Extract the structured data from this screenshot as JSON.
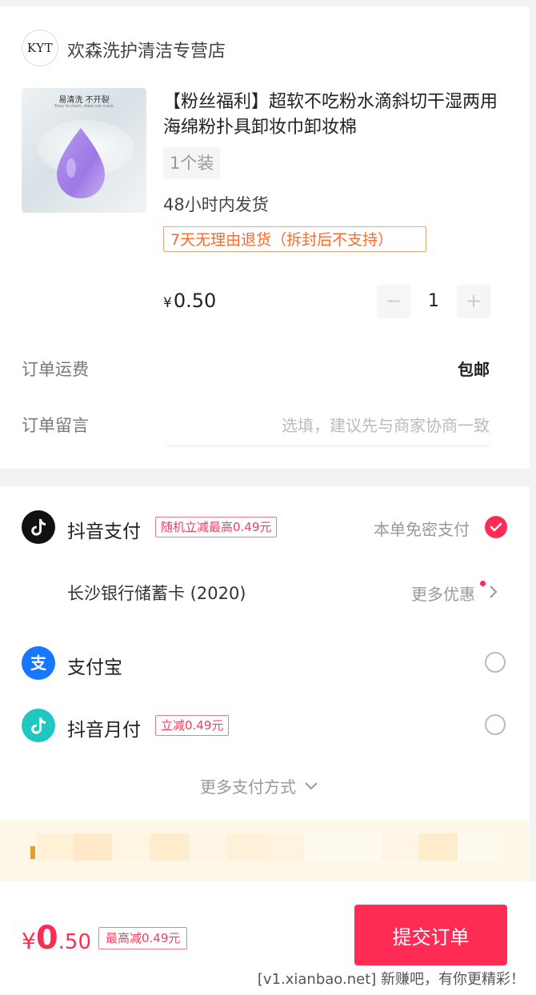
{
  "store": {
    "logo_text": "KYT",
    "name": "欢森洗护清洁专营店"
  },
  "product": {
    "image_tagline": "易清洗 不开裂",
    "image_tagline_en": "Easy to clean, does not crack",
    "title": "【粉丝福利】超软不吃粉水滴斜切干湿两用海绵粉扑具卸妆巾卸妆棉",
    "spec": "1个装",
    "ship_time": "48小时内发货",
    "return_policy": "7天无理由退货（拆封后不支持）",
    "price_symbol": "¥",
    "price": "0.50",
    "quantity": "1",
    "minus_label": "−",
    "plus_label": "+"
  },
  "order": {
    "shipping_label": "订单运费",
    "shipping_value": "包邮",
    "message_label": "订单留言",
    "message_placeholder": "选填，建议先与商家协商一致"
  },
  "payment": {
    "douyin_pay": {
      "name": "抖音支付",
      "promo": "随机立减最高0.49元",
      "free_pay_label": "本单免密支付",
      "selected": true
    },
    "bank_card": "长沙银行储蓄卡 (2020)",
    "more_offers": "更多优惠",
    "alipay": {
      "name": "支付宝",
      "selected": false
    },
    "douyin_monthly": {
      "name": "抖音月付",
      "promo": "立减0.49元",
      "selected": false
    },
    "more_methods": "更多支付方式"
  },
  "footer": {
    "total_symbol": "¥",
    "total_int": "0",
    "total_dec": ".50",
    "max_discount": "最高减0.49元",
    "submit_label": "提交订单",
    "watermark": "[v1.xianbao.net] 新赚吧，有你更精彩！"
  },
  "colors": {
    "accent": "#fe2c55",
    "orange": "#ff6a2a",
    "alipay_blue": "#1677ff",
    "monthly_teal": "#1fc7c1"
  },
  "icons": [
    "douyin-logo-icon",
    "alipay-icon",
    "douyin-monthly-icon",
    "check-icon",
    "chevron-right-icon",
    "chevron-down-icon"
  ]
}
